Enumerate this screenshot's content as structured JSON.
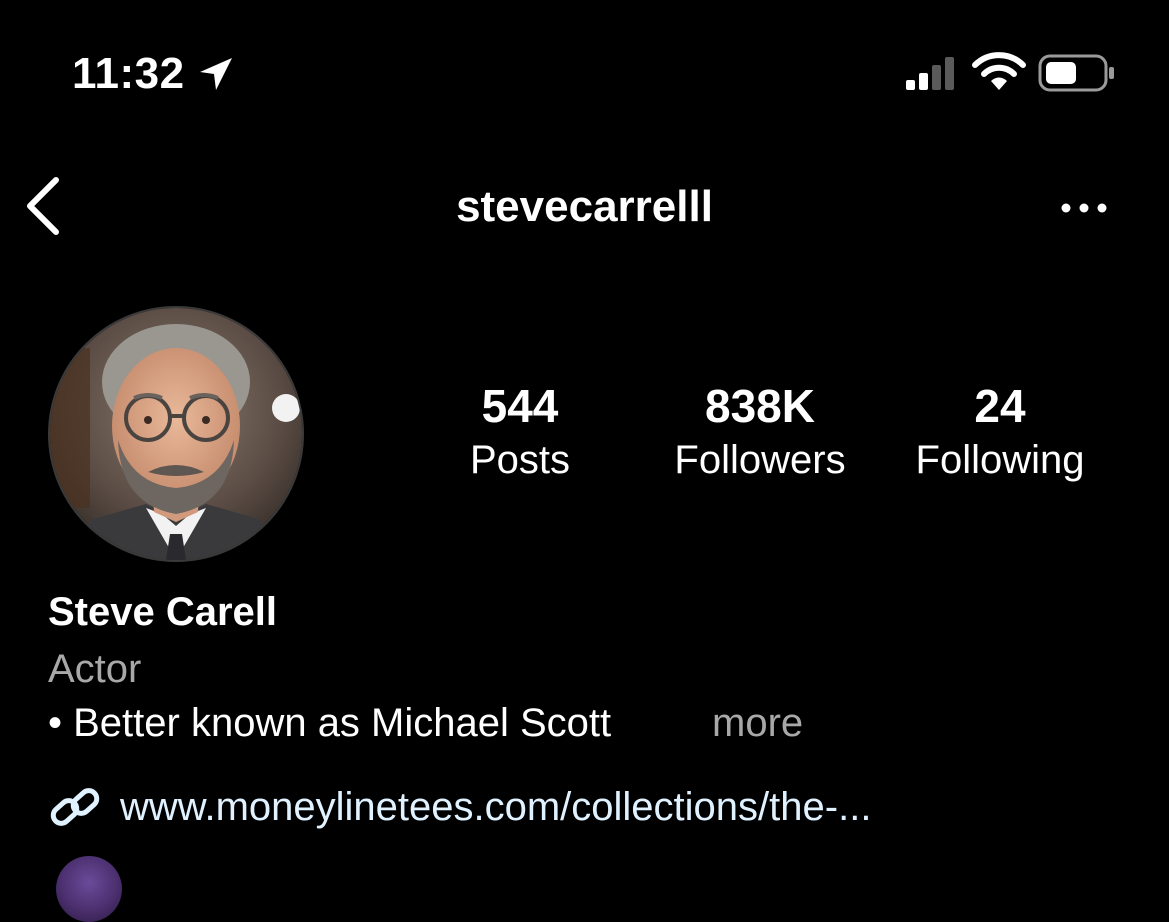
{
  "status_bar": {
    "time": "11:32",
    "location_icon": "location-arrow-icon",
    "signal_icon": "cellular-signal-icon",
    "wifi_icon": "wifi-icon",
    "battery_icon": "battery-icon"
  },
  "nav": {
    "back_icon": "chevron-left-icon",
    "username": "stevecarrelll",
    "more_icon": "ellipsis-icon"
  },
  "profile": {
    "avatar": "profile-photo",
    "stats": {
      "posts": {
        "value": "544",
        "label": "Posts"
      },
      "followers": {
        "value": "838K",
        "label": "Followers"
      },
      "following": {
        "value": "24",
        "label": "Following"
      }
    },
    "display_name": "Steve Carell",
    "category": "Actor",
    "bio": "• Better known as Michael Scott",
    "bio_more": "more",
    "link_icon": "link-icon",
    "link": "www.moneylinetees.com/collections/the-..."
  },
  "colors": {
    "background": "#000000",
    "text": "#ffffff",
    "muted": "#a8a8a8",
    "link": "#e0f1ff"
  }
}
